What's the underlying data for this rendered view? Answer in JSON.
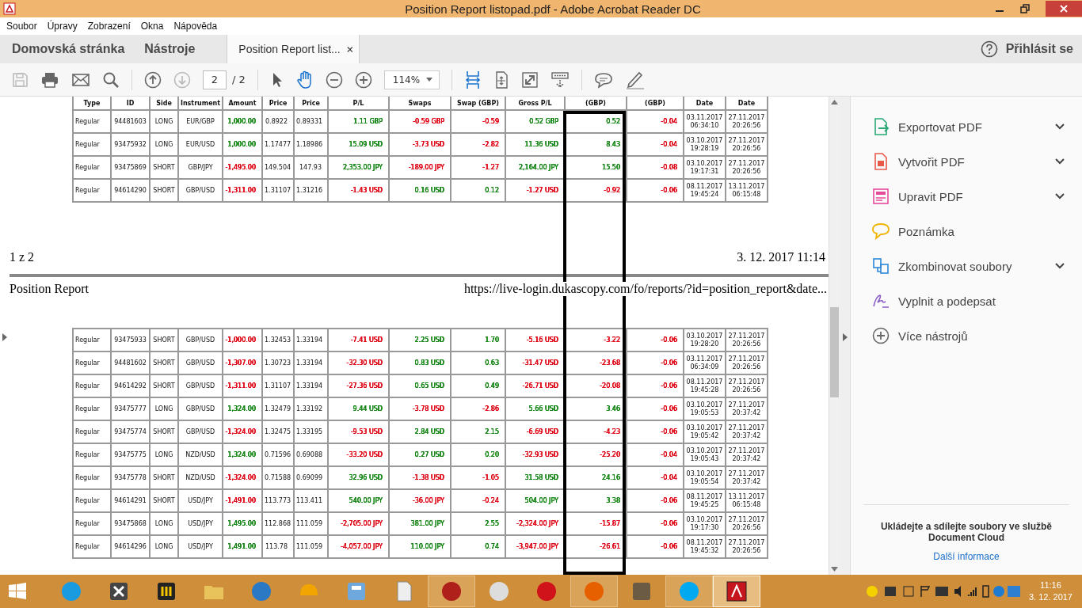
{
  "window": {
    "title": "Position Report listopad.pdf - Adobe Acrobat Reader DC"
  },
  "menu": [
    "Soubor",
    "Úpravy",
    "Zobrazení",
    "Okna",
    "Nápověda"
  ],
  "tabs": {
    "home": "Domovská stránka",
    "tools": "Nástroje",
    "document": "Position Report list...",
    "sign_in": "Přihlásit se"
  },
  "toolbar": {
    "page": "2",
    "page_count": "/ 2",
    "zoom": "114%"
  },
  "document": {
    "columns": [
      "Type",
      "ID",
      "Side",
      "Instrument",
      "Amount",
      "Price",
      "Price",
      "P/L",
      "Swaps",
      "Swap (GBP)",
      "Gross P/L",
      "(GBP)",
      "(GBP)",
      "Date",
      "Date"
    ],
    "top_rows": [
      {
        "cells": [
          {
            "text": "Regular"
          },
          {
            "text": "94481603"
          },
          {
            "text": "LONG"
          },
          {
            "text": "EUR/GBP"
          },
          {
            "text": "1,000.00",
            "color": "#1d8a1d"
          },
          {
            "text": "0.8922"
          },
          {
            "text": "0.89331"
          },
          {
            "text": "1.11 GBP",
            "color": "#1d8a1d"
          },
          {
            "text": "-0.59 GBP",
            "color": "#e0101e"
          },
          {
            "text": "-0.59",
            "color": "#e0101e"
          },
          {
            "text": "0.52 GBP",
            "color": "#1d8a1d"
          },
          {
            "text": "0.52",
            "color": "#1d8a1d"
          },
          {
            "text": "-0.04",
            "color": "#e0101e"
          },
          {
            "text": "03.11.2017\n06:34:10"
          },
          {
            "text": "27.11.2017\n20:26:56"
          }
        ]
      },
      {
        "cells": [
          {
            "text": "Regular"
          },
          {
            "text": "93475932"
          },
          {
            "text": "LONG"
          },
          {
            "text": "EUR/USD"
          },
          {
            "text": "1,000.00",
            "color": "#1d8a1d"
          },
          {
            "text": "1.17477"
          },
          {
            "text": "1.18986"
          },
          {
            "text": "15.09 USD",
            "color": "#1d8a1d"
          },
          {
            "text": "-3.73 USD",
            "color": "#e0101e"
          },
          {
            "text": "-2.82",
            "color": "#e0101e"
          },
          {
            "text": "11.36 USD",
            "color": "#1d8a1d"
          },
          {
            "text": "8.43",
            "color": "#1d8a1d"
          },
          {
            "text": "-0.04",
            "color": "#e0101e"
          },
          {
            "text": "03.10.2017\n19:28:19"
          },
          {
            "text": "27.11.2017\n20:26:56"
          }
        ]
      },
      {
        "cells": [
          {
            "text": "Regular"
          },
          {
            "text": "93475869"
          },
          {
            "text": "SHORT"
          },
          {
            "text": "GBP/JPY"
          },
          {
            "text": "-1,495.00",
            "color": "#e0101e"
          },
          {
            "text": "149.504"
          },
          {
            "text": "147.93"
          },
          {
            "text": "2,353.00 JPY",
            "color": "#1d8a1d"
          },
          {
            "text": "-189.00 JPY",
            "color": "#e0101e"
          },
          {
            "text": "-1.27",
            "color": "#e0101e"
          },
          {
            "text": "2,164.00 JPY",
            "color": "#1d8a1d"
          },
          {
            "text": "15.50",
            "color": "#1d8a1d"
          },
          {
            "text": "-0.08",
            "color": "#e0101e"
          },
          {
            "text": "03.10.2017\n19:17:31"
          },
          {
            "text": "27.11.2017\n20:26:56"
          }
        ]
      },
      {
        "cells": [
          {
            "text": "Regular"
          },
          {
            "text": "94614290"
          },
          {
            "text": "SHORT"
          },
          {
            "text": "GBP/USD"
          },
          {
            "text": "-1,311.00",
            "color": "#e0101e"
          },
          {
            "text": "1.31107"
          },
          {
            "text": "1.31216"
          },
          {
            "text": "-1.43 USD",
            "color": "#e0101e"
          },
          {
            "text": "0.16 USD",
            "color": "#1d8a1d"
          },
          {
            "text": "0.12",
            "color": "#1d8a1d"
          },
          {
            "text": "-1.27 USD",
            "color": "#e0101e"
          },
          {
            "text": "-0.92",
            "color": "#e0101e"
          },
          {
            "text": "-0.06",
            "color": "#e0101e"
          },
          {
            "text": "08.11.2017\n19:45:24"
          },
          {
            "text": "13.11.2017\n06:15:48"
          }
        ]
      }
    ],
    "footer": {
      "page": "1 z 2",
      "date": "3. 12. 2017 11:14"
    },
    "page_header": {
      "title": "Position Report",
      "url": "https://live-login.dukascopy.com/fo/reports/?id=position_report&date..."
    },
    "bottom_rows": [
      {
        "cells": [
          {
            "text": "Regular"
          },
          {
            "text": "93475933"
          },
          {
            "text": "SHORT"
          },
          {
            "text": "GBP/USD"
          },
          {
            "text": "-1,000.00",
            "color": "#e0101e"
          },
          {
            "text": "1.32453"
          },
          {
            "text": "1.33194"
          },
          {
            "text": "-7.41 USD",
            "color": "#e0101e"
          },
          {
            "text": "2.25 USD",
            "color": "#1d8a1d"
          },
          {
            "text": "1.70",
            "color": "#1d8a1d"
          },
          {
            "text": "-5.16 USD",
            "color": "#e0101e"
          },
          {
            "text": "-3.22",
            "color": "#e0101e"
          },
          {
            "text": "-0.06",
            "color": "#e0101e"
          },
          {
            "text": "03.10.2017\n19:28:20"
          },
          {
            "text": "27.11.2017\n20:26:56"
          }
        ]
      },
      {
        "cells": [
          {
            "text": "Regular"
          },
          {
            "text": "94481602"
          },
          {
            "text": "SHORT"
          },
          {
            "text": "GBP/USD"
          },
          {
            "text": "-1,307.00",
            "color": "#e0101e"
          },
          {
            "text": "1.30723"
          },
          {
            "text": "1.33194"
          },
          {
            "text": "-32.30 USD",
            "color": "#e0101e"
          },
          {
            "text": "0.83 USD",
            "color": "#1d8a1d"
          },
          {
            "text": "0.63",
            "color": "#1d8a1d"
          },
          {
            "text": "-31.47 USD",
            "color": "#e0101e"
          },
          {
            "text": "-23.68",
            "color": "#e0101e"
          },
          {
            "text": "-0.06",
            "color": "#e0101e"
          },
          {
            "text": "03.11.2017\n06:34:09"
          },
          {
            "text": "27.11.2017\n20:26:56"
          }
        ]
      },
      {
        "cells": [
          {
            "text": "Regular"
          },
          {
            "text": "94614292"
          },
          {
            "text": "SHORT"
          },
          {
            "text": "GBP/USD"
          },
          {
            "text": "-1,311.00",
            "color": "#e0101e"
          },
          {
            "text": "1.31107"
          },
          {
            "text": "1.33194"
          },
          {
            "text": "-27.36 USD",
            "color": "#e0101e"
          },
          {
            "text": "0.65 USD",
            "color": "#1d8a1d"
          },
          {
            "text": "0.49",
            "color": "#1d8a1d"
          },
          {
            "text": "-26.71 USD",
            "color": "#e0101e"
          },
          {
            "text": "-20.08",
            "color": "#e0101e"
          },
          {
            "text": "-0.06",
            "color": "#e0101e"
          },
          {
            "text": "08.11.2017\n19:45:28"
          },
          {
            "text": "27.11.2017\n20:26:56"
          }
        ]
      },
      {
        "cells": [
          {
            "text": "Regular"
          },
          {
            "text": "93475777"
          },
          {
            "text": "LONG"
          },
          {
            "text": "GBP/USD"
          },
          {
            "text": "1,324.00",
            "color": "#1d8a1d"
          },
          {
            "text": "1.32479"
          },
          {
            "text": "1.33192"
          },
          {
            "text": "9.44 USD",
            "color": "#1d8a1d"
          },
          {
            "text": "-3.78 USD",
            "color": "#e0101e"
          },
          {
            "text": "-2.86",
            "color": "#e0101e"
          },
          {
            "text": "5.66 USD",
            "color": "#1d8a1d"
          },
          {
            "text": "3.46",
            "color": "#1d8a1d"
          },
          {
            "text": "-0.06",
            "color": "#e0101e"
          },
          {
            "text": "03.10.2017\n19:05:53"
          },
          {
            "text": "27.11.2017\n20:37:42"
          }
        ]
      },
      {
        "cells": [
          {
            "text": "Regular"
          },
          {
            "text": "93475774"
          },
          {
            "text": "SHORT"
          },
          {
            "text": "GBP/USD"
          },
          {
            "text": "-1,324.00",
            "color": "#e0101e"
          },
          {
            "text": "1.32475"
          },
          {
            "text": "1.33195"
          },
          {
            "text": "-9.53 USD",
            "color": "#e0101e"
          },
          {
            "text": "2.84 USD",
            "color": "#1d8a1d"
          },
          {
            "text": "2.15",
            "color": "#1d8a1d"
          },
          {
            "text": "-6.69 USD",
            "color": "#e0101e"
          },
          {
            "text": "-4.23",
            "color": "#e0101e"
          },
          {
            "text": "-0.06",
            "color": "#e0101e"
          },
          {
            "text": "03.10.2017\n19:05:42"
          },
          {
            "text": "27.11.2017\n20:37:42"
          }
        ]
      },
      {
        "cells": [
          {
            "text": "Regular"
          },
          {
            "text": "93475775"
          },
          {
            "text": "LONG"
          },
          {
            "text": "NZD/USD"
          },
          {
            "text": "1,324.00",
            "color": "#1d8a1d"
          },
          {
            "text": "0.71596"
          },
          {
            "text": "0.69088"
          },
          {
            "text": "-33.20 USD",
            "color": "#e0101e"
          },
          {
            "text": "0.27 USD",
            "color": "#1d8a1d"
          },
          {
            "text": "0.20",
            "color": "#1d8a1d"
          },
          {
            "text": "-32.93 USD",
            "color": "#e0101e"
          },
          {
            "text": "-25.20",
            "color": "#e0101e"
          },
          {
            "text": "-0.04",
            "color": "#e0101e"
          },
          {
            "text": "03.10.2017\n19:05:43"
          },
          {
            "text": "27.11.2017\n20:37:42"
          }
        ]
      },
      {
        "cells": [
          {
            "text": "Regular"
          },
          {
            "text": "93475778"
          },
          {
            "text": "SHORT"
          },
          {
            "text": "NZD/USD"
          },
          {
            "text": "-1,324.00",
            "color": "#e0101e"
          },
          {
            "text": "0.71588"
          },
          {
            "text": "0.69099"
          },
          {
            "text": "32.96 USD",
            "color": "#1d8a1d"
          },
          {
            "text": "-1.38 USD",
            "color": "#e0101e"
          },
          {
            "text": "-1.05",
            "color": "#e0101e"
          },
          {
            "text": "31.58 USD",
            "color": "#1d8a1d"
          },
          {
            "text": "24.16",
            "color": "#1d8a1d"
          },
          {
            "text": "-0.04",
            "color": "#e0101e"
          },
          {
            "text": "03.10.2017\n19:05:54"
          },
          {
            "text": "27.11.2017\n20:37:42"
          }
        ]
      },
      {
        "cells": [
          {
            "text": "Regular"
          },
          {
            "text": "94614291"
          },
          {
            "text": "SHORT"
          },
          {
            "text": "USD/JPY"
          },
          {
            "text": "-1,491.00",
            "color": "#e0101e"
          },
          {
            "text": "113.773"
          },
          {
            "text": "113.411"
          },
          {
            "text": "540.00 JPY",
            "color": "#1d8a1d"
          },
          {
            "text": "-36.00 JPY",
            "color": "#e0101e"
          },
          {
            "text": "-0.24",
            "color": "#e0101e"
          },
          {
            "text": "504.00 JPY",
            "color": "#1d8a1d"
          },
          {
            "text": "3.38",
            "color": "#1d8a1d"
          },
          {
            "text": "-0.06",
            "color": "#e0101e"
          },
          {
            "text": "08.11.2017\n19:45:25"
          },
          {
            "text": "13.11.2017\n06:15:48"
          }
        ]
      },
      {
        "cells": [
          {
            "text": "Regular"
          },
          {
            "text": "93475868"
          },
          {
            "text": "LONG"
          },
          {
            "text": "USD/JPY"
          },
          {
            "text": "1,495.00",
            "color": "#1d8a1d"
          },
          {
            "text": "112.868"
          },
          {
            "text": "111.059"
          },
          {
            "text": "-2,705.00 JPY",
            "color": "#e0101e"
          },
          {
            "text": "381.00 JPY",
            "color": "#1d8a1d"
          },
          {
            "text": "2.55",
            "color": "#1d8a1d"
          },
          {
            "text": "-2,324.00 JPY",
            "color": "#e0101e"
          },
          {
            "text": "-15.87",
            "color": "#e0101e"
          },
          {
            "text": "-0.06",
            "color": "#e0101e"
          },
          {
            "text": "03.10.2017\n19:17:30"
          },
          {
            "text": "27.11.2017\n20:26:56"
          }
        ]
      },
      {
        "cells": [
          {
            "text": "Regular"
          },
          {
            "text": "94614296"
          },
          {
            "text": "LONG"
          },
          {
            "text": "USD/JPY"
          },
          {
            "text": "1,491.00",
            "color": "#1d8a1d"
          },
          {
            "text": "113.78"
          },
          {
            "text": "111.059"
          },
          {
            "text": "-4,057.00 JPY",
            "color": "#e0101e"
          },
          {
            "text": "110.00 JPY",
            "color": "#1d8a1d"
          },
          {
            "text": "0.74",
            "color": "#1d8a1d"
          },
          {
            "text": "-3,947.00 JPY",
            "color": "#e0101e"
          },
          {
            "text": "-26.61",
            "color": "#e0101e"
          },
          {
            "text": "-0.06",
            "color": "#e0101e"
          },
          {
            "text": "08.11.2017\n19:45:32"
          },
          {
            "text": "27.11.2017\n20:26:56"
          }
        ]
      }
    ]
  },
  "tools_pane": {
    "items": [
      {
        "label": "Exportovat PDF",
        "kind": "export",
        "expandable": true
      },
      {
        "label": "Vytvořit PDF",
        "kind": "create",
        "expandable": true
      },
      {
        "label": "Upravit PDF",
        "kind": "edit",
        "expandable": true
      },
      {
        "label": "Poznámka",
        "kind": "comment",
        "expandable": false
      },
      {
        "label": "Zkombinovat soubory",
        "kind": "combine",
        "expandable": true
      },
      {
        "label": "Vyplnit a podepsat",
        "kind": "sign",
        "expandable": false
      },
      {
        "label": "Více nástrojů",
        "kind": "more",
        "expandable": false
      }
    ],
    "promo": {
      "text": "Ukládejte a sdílejte soubory ve službě Document Cloud",
      "link": "Další informace"
    }
  },
  "taskbar": {
    "apps": [
      {
        "kind": "ie",
        "running": false,
        "selected": false
      },
      {
        "kind": "x",
        "running": false,
        "selected": false
      },
      {
        "kind": "bars",
        "running": false,
        "selected": false
      },
      {
        "kind": "folder",
        "running": false,
        "selected": false
      },
      {
        "kind": "bird",
        "running": false,
        "selected": false
      },
      {
        "kind": "helmet",
        "running": false,
        "selected": false
      },
      {
        "kind": "calc",
        "running": false,
        "selected": false
      },
      {
        "kind": "doc",
        "running": false,
        "selected": false
      },
      {
        "kind": "flash",
        "running": true,
        "selected": false
      },
      {
        "kind": "palette",
        "running": false,
        "selected": false
      },
      {
        "kind": "gear",
        "running": false,
        "selected": false
      },
      {
        "kind": "firefox",
        "running": true,
        "selected": false
      },
      {
        "kind": "gimp",
        "running": false,
        "selected": false
      },
      {
        "kind": "skype",
        "running": true,
        "selected": false
      },
      {
        "kind": "acrobat",
        "running": true,
        "selected": true
      }
    ],
    "clock": {
      "time": "11:16",
      "date": "3. 12. 2017"
    }
  }
}
